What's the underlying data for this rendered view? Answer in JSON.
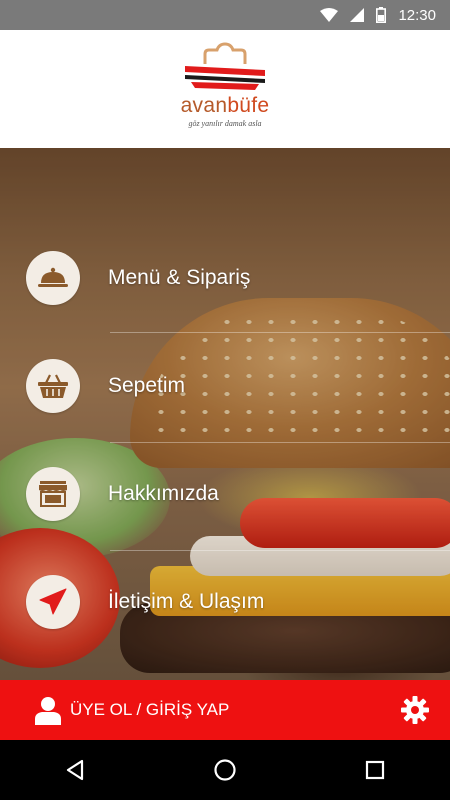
{
  "status_bar": {
    "time": "12:30",
    "icons": [
      "wifi-icon",
      "signal-icon",
      "battery-icon"
    ]
  },
  "header": {
    "brand_part1": "avan",
    "brand_part2": "büfe",
    "tagline": "göz yanılır damak asla"
  },
  "menu": {
    "items": [
      {
        "label": "Menü & Sipariş",
        "icon": "cloche-icon"
      },
      {
        "label": "Sepetim",
        "icon": "basket-icon"
      },
      {
        "label": "Hakkımızda",
        "icon": "storefront-icon"
      },
      {
        "label": "İletişim & Ulaşım",
        "icon": "paper-plane-icon"
      }
    ]
  },
  "bottom_bar": {
    "login_label": "ÜYE OL / GİRİŞ YAP",
    "left_icon": "user-icon",
    "right_icon": "gear-icon"
  },
  "nav_bar": {
    "buttons": [
      "back-icon",
      "home-icon",
      "recents-icon"
    ]
  },
  "colors": {
    "accent_red": "#ee1111",
    "icon_brown": "#8b5a2b",
    "icon_bg": "#f3ede5",
    "status_bar": "#7a7a7a"
  }
}
